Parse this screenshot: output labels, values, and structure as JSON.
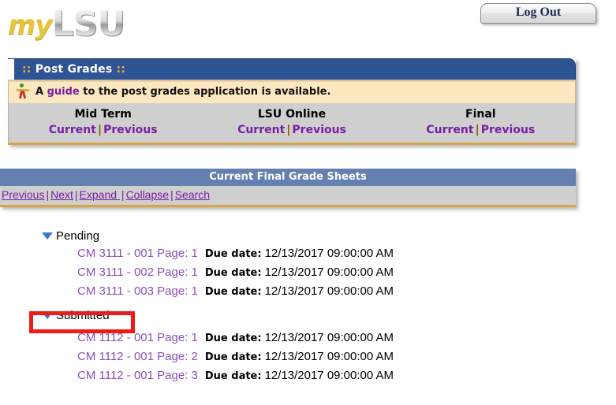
{
  "header": {
    "logo_my": "my",
    "logo_lsu": "LSU",
    "logout_label": "Log Out"
  },
  "post_grades_panel": {
    "title": "Post Grades",
    "title_decoration": "::",
    "notice": {
      "icon": "guide-person-icon",
      "prefix": "A ",
      "link": "guide",
      "suffix": " to the post grades application is available."
    },
    "terms": [
      {
        "name": "Mid Term",
        "current": "Current",
        "separator": "|",
        "previous": "Previous"
      },
      {
        "name": "LSU Online",
        "current": "Current",
        "separator": "|",
        "previous": "Previous"
      },
      {
        "name": "Final",
        "current": "Current",
        "separator": "|",
        "previous": "Previous"
      }
    ]
  },
  "grade_sheets_panel": {
    "title": "Current Final Grade Sheets",
    "toolbar": {
      "previous": "Previous",
      "next": "Next",
      "expand": "Expand ",
      "collapse": "Collapse",
      "search": "Search",
      "separator": "|"
    }
  },
  "tree": {
    "groups": [
      {
        "label": "Pending",
        "expanded": true,
        "highlighted": false,
        "rows": [
          {
            "course": "CM 3111 - 001 Page: 1",
            "due_label": "Due date:",
            "due_value": "12/13/2017 09:00:00 AM"
          },
          {
            "course": "CM 3111 - 002 Page: 1",
            "due_label": "Due date:",
            "due_value": "12/13/2017 09:00:00 AM"
          },
          {
            "course": "CM 3111 - 003 Page: 1",
            "due_label": "Due date:",
            "due_value": "12/13/2017 09:00:00 AM"
          }
        ]
      },
      {
        "label": "Submitted",
        "expanded": true,
        "highlighted": true,
        "rows": [
          {
            "course": "CM 1112 - 001 Page: 1",
            "due_label": "Due date:",
            "due_value": "12/13/2017 09:00:00 AM"
          },
          {
            "course": "CM 1112 - 001 Page: 2",
            "due_label": "Due date:",
            "due_value": "12/13/2017 09:00:00 AM"
          },
          {
            "course": "CM 1112 - 001 Page: 3",
            "due_label": "Due date:",
            "due_value": "12/13/2017 09:00:00 AM"
          }
        ]
      }
    ]
  },
  "colors": {
    "brand_gold": "#e8c33c",
    "panel_header_navy": "#2e5496",
    "panel_header_slate": "#6380b0",
    "link_purple": "#7a1fa2",
    "notice_cream": "#fbe8c0",
    "panel_gray": "#cfcfcf",
    "gold_rule": "#d9a441",
    "annotation_red": "#ee1c17"
  }
}
